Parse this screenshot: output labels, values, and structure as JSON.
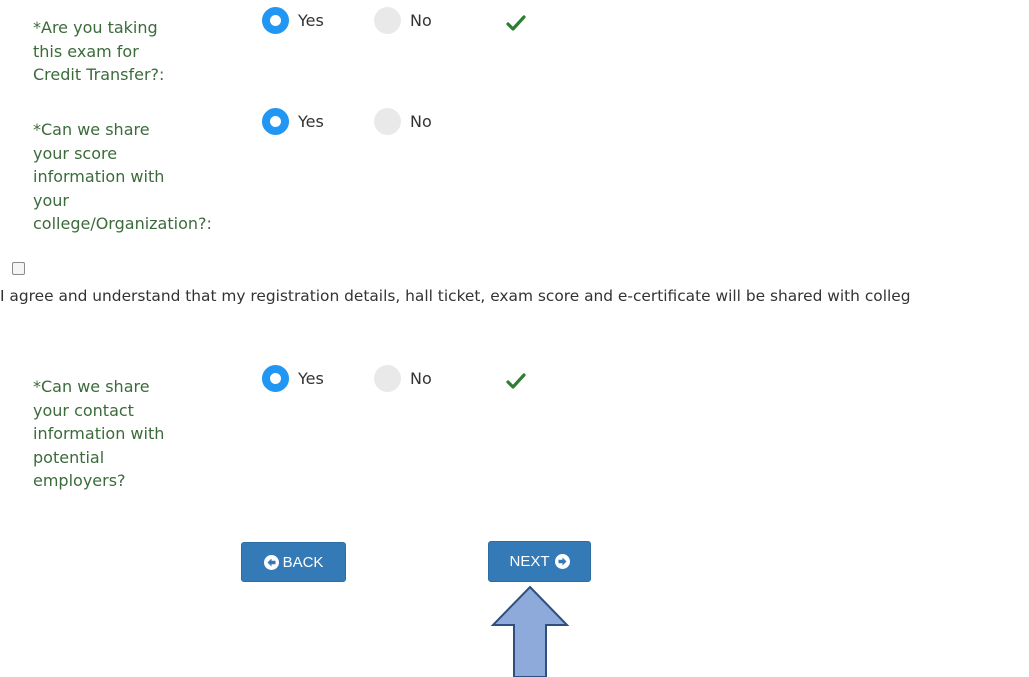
{
  "questions": [
    {
      "label": "*Are you taking\nthis exam for\nCredit Transfer?:",
      "yes": "Yes",
      "no": "No",
      "selected": "Yes",
      "valid": true
    },
    {
      "label": "*Can we share\nyour score\ninformation with\nyour\ncollege/Organization?:",
      "yes": "Yes",
      "no": "No",
      "selected": "Yes",
      "valid": false
    },
    {
      "label": "*Can we share\nyour contact\ninformation with\npotential\nemployers?",
      "yes": "Yes",
      "no": "No",
      "selected": "Yes",
      "valid": true
    }
  ],
  "agreement": {
    "checked": false,
    "text": "I agree and understand that my registration details, hall ticket, exam score and e-certificate will be shared with colleg"
  },
  "buttons": {
    "back": "BACK",
    "next": "NEXT"
  },
  "icons": {
    "check": "checkmark-icon",
    "back": "circle-arrow-left-icon",
    "next": "circle-arrow-right-icon",
    "annotation": "up-arrow-annotation"
  },
  "colors": {
    "label_text": "#3b6b3b",
    "radio_selected": "#2196f3",
    "button_bg": "#337ab7",
    "check_green": "#2e7d32",
    "arrow_fill": "#8eaadb",
    "arrow_stroke": "#2f4f7f"
  }
}
